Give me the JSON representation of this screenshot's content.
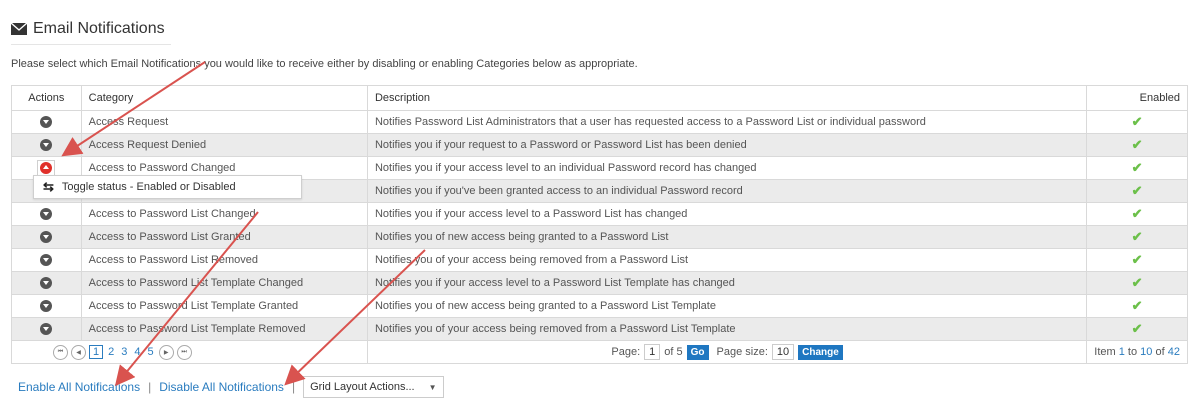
{
  "header": {
    "title": "Email Notifications",
    "intro": "Please select which Email Notifications you would like to receive either by disabling or enabling Categories below as appropriate."
  },
  "grid": {
    "columns": [
      "Actions",
      "Category",
      "Description",
      "Enabled"
    ],
    "rows": [
      {
        "category": "Access Request",
        "description": "Notifies Password List Administrators that a user has requested access to a Password List or individual password",
        "enabled": "✔"
      },
      {
        "category": "Access Request Denied",
        "description": "Notifies you if your request to a Password or Password List has been denied",
        "enabled": "✔"
      },
      {
        "category": "Access to Password Changed",
        "description": "Notifies you if your access level to an individual Password record has changed",
        "enabled": "✔"
      },
      {
        "category": "",
        "description": "Notifies you if you've been granted access to an individual Password record",
        "enabled": "✔"
      },
      {
        "category": "Access to Password List Changed",
        "description": "Notifies you if your access level to a Password List has changed",
        "enabled": "✔"
      },
      {
        "category": "Access to Password List Granted",
        "description": "Notifies you of new access being granted to a Password List",
        "enabled": "✔"
      },
      {
        "category": "Access to Password List Removed",
        "description": "Notifies you of your access being removed from a Password List",
        "enabled": "✔"
      },
      {
        "category": "Access to Password List Template Changed",
        "description": "Notifies you if your access level to a Password List Template has changed",
        "enabled": "✔"
      },
      {
        "category": "Access to Password List Template Granted",
        "description": "Notifies you of new access being granted to a Password List Template",
        "enabled": "✔"
      },
      {
        "category": "Access to Password List Template Removed",
        "description": "Notifies you of your access being removed from a Password List Template",
        "enabled": "✔"
      }
    ]
  },
  "tooltip": {
    "text": "Toggle status - Enabled or Disabled"
  },
  "pager": {
    "pages": [
      "1",
      "2",
      "3",
      "4",
      "5"
    ],
    "page_label": "Page:",
    "page_value": "1",
    "of_label": "of 5",
    "go_label": "Go",
    "page_size_label": "Page size:",
    "page_size_value": "10",
    "change_label": "Change",
    "item_prefix": "Item",
    "item_from": "1",
    "item_to_label": "to",
    "item_to": "10",
    "item_of_label": "of",
    "item_total": "42"
  },
  "footer": {
    "enable_all": "Enable All Notifications",
    "disable_all": "Disable All Notifications",
    "separator": "|",
    "grid_actions": "Grid Layout Actions..."
  },
  "colors": {
    "accent": "#2a7cbf",
    "active_red": "#e0302a",
    "check_green": "#6cc04a",
    "arrow": "#d9534f"
  },
  "icons": [
    "envelope-icon",
    "caret-down-icon",
    "caret-up-icon",
    "toggle-icon",
    "check-icon",
    "first-page-icon",
    "prev-page-icon",
    "next-page-icon",
    "last-page-icon"
  ]
}
